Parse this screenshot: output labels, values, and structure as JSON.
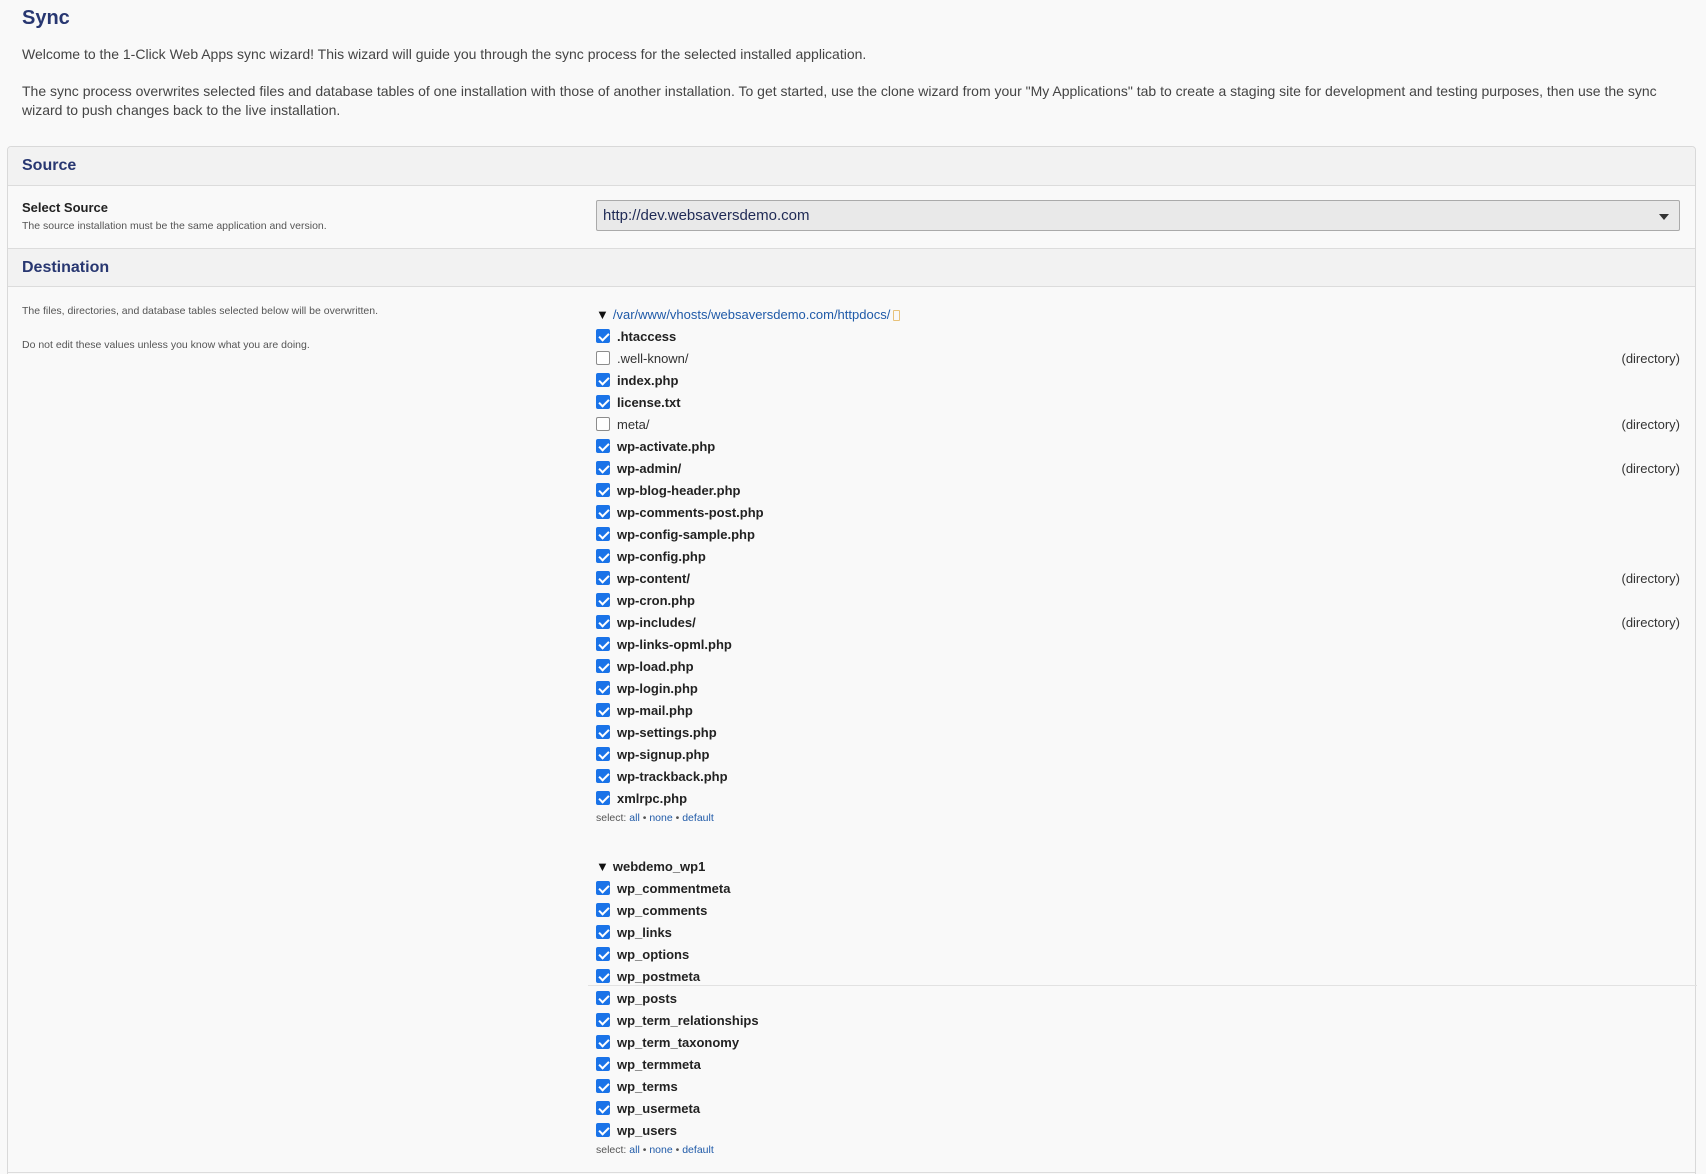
{
  "page": {
    "title": "Sync",
    "intro_1": "Welcome to the 1-Click Web Apps sync wizard! This wizard will guide you through the sync process for the selected installed application.",
    "intro_2": "The sync process overwrites selected files and database tables of one installation with those of another installation. To get started, use the clone wizard from your \"My Applications\" tab to create a staging site for development and testing purposes, then use the sync wizard to push changes back to the live installation."
  },
  "source": {
    "heading": "Source",
    "label": "Select Source",
    "help": "The source installation must be the same application and version.",
    "selected": "http://dev.websaversdemo.com"
  },
  "destination": {
    "heading": "Destination",
    "help_1": "The files, directories, and database tables selected below will be overwritten.",
    "help_2": "Do not edit these values unless you know what you are doing."
  },
  "files": {
    "path": "/var/www/vhosts/websaversdemo.com/httpdocs/",
    "items": [
      {
        "name": ".htaccess",
        "checked": true,
        "kind": ""
      },
      {
        "name": ".well-known/",
        "checked": false,
        "kind": "(directory)"
      },
      {
        "name": "index.php",
        "checked": true,
        "kind": ""
      },
      {
        "name": "license.txt",
        "checked": true,
        "kind": ""
      },
      {
        "name": "meta/",
        "checked": false,
        "kind": "(directory)"
      },
      {
        "name": "wp-activate.php",
        "checked": true,
        "kind": ""
      },
      {
        "name": "wp-admin/",
        "checked": true,
        "kind": "(directory)"
      },
      {
        "name": "wp-blog-header.php",
        "checked": true,
        "kind": ""
      },
      {
        "name": "wp-comments-post.php",
        "checked": true,
        "kind": ""
      },
      {
        "name": "wp-config-sample.php",
        "checked": true,
        "kind": ""
      },
      {
        "name": "wp-config.php",
        "checked": true,
        "kind": ""
      },
      {
        "name": "wp-content/",
        "checked": true,
        "kind": "(directory)"
      },
      {
        "name": "wp-cron.php",
        "checked": true,
        "kind": ""
      },
      {
        "name": "wp-includes/",
        "checked": true,
        "kind": "(directory)"
      },
      {
        "name": "wp-links-opml.php",
        "checked": true,
        "kind": ""
      },
      {
        "name": "wp-load.php",
        "checked": true,
        "kind": ""
      },
      {
        "name": "wp-login.php",
        "checked": true,
        "kind": ""
      },
      {
        "name": "wp-mail.php",
        "checked": true,
        "kind": ""
      },
      {
        "name": "wp-settings.php",
        "checked": true,
        "kind": ""
      },
      {
        "name": "wp-signup.php",
        "checked": true,
        "kind": ""
      },
      {
        "name": "wp-trackback.php",
        "checked": true,
        "kind": ""
      },
      {
        "name": "xmlrpc.php",
        "checked": true,
        "kind": ""
      }
    ]
  },
  "database": {
    "name": "webdemo_wp1",
    "items": [
      {
        "name": "wp_commentmeta",
        "checked": true
      },
      {
        "name": "wp_comments",
        "checked": true
      },
      {
        "name": "wp_links",
        "checked": true
      },
      {
        "name": "wp_options",
        "checked": true
      },
      {
        "name": "wp_postmeta",
        "checked": true
      },
      {
        "name": "wp_posts",
        "checked": true
      },
      {
        "name": "wp_term_relationships",
        "checked": true
      },
      {
        "name": "wp_term_taxonomy",
        "checked": true
      },
      {
        "name": "wp_termmeta",
        "checked": true
      },
      {
        "name": "wp_terms",
        "checked": true
      },
      {
        "name": "wp_usermeta",
        "checked": true
      },
      {
        "name": "wp_users",
        "checked": true
      }
    ]
  },
  "select_links": {
    "prefix": "select:",
    "all": "all",
    "none": "none",
    "default": "default",
    "separator": "•"
  },
  "icons": {
    "expand": "triangle-down-icon",
    "dropdown": "chevron-down-icon",
    "copy": "copy-icon"
  },
  "colors": {
    "heading": "#283771",
    "link": "#1f5aa8",
    "checkbox": "#1a73e8"
  }
}
